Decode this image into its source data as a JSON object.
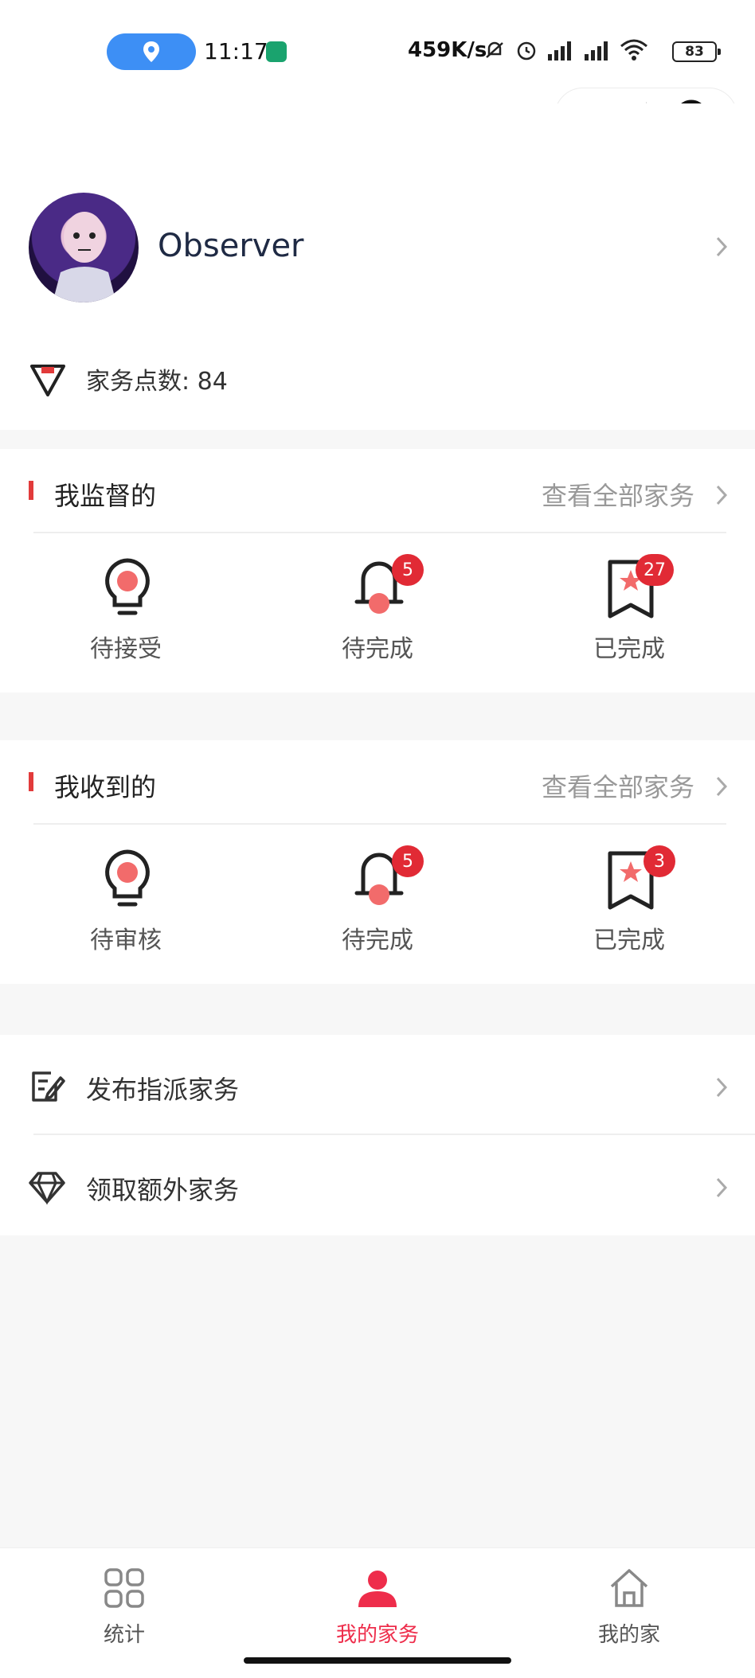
{
  "status_bar": {
    "time": "11:17",
    "net_speed": "459K/s",
    "battery": "83"
  },
  "profile": {
    "username": "Observer",
    "points_label": "家务点数: 84"
  },
  "supervise": {
    "title": "我监督的",
    "view_all": "查看全部家务",
    "items": [
      {
        "label": "待接受",
        "icon": "lightbulb-icon",
        "badge": ""
      },
      {
        "label": "待完成",
        "icon": "bell-icon",
        "badge": "5"
      },
      {
        "label": "已完成",
        "icon": "bookmark-star-icon",
        "badge": "27"
      }
    ]
  },
  "received": {
    "title": "我收到的",
    "view_all": "查看全部家务",
    "items": [
      {
        "label": "待审核",
        "icon": "lightbulb-icon",
        "badge": ""
      },
      {
        "label": "待完成",
        "icon": "bell-icon",
        "badge": "5"
      },
      {
        "label": "已完成",
        "icon": "bookmark-star-icon",
        "badge": "3"
      }
    ]
  },
  "menu": {
    "items": [
      {
        "label": "发布指派家务",
        "icon": "edit-note-icon"
      },
      {
        "label": "领取额外家务",
        "icon": "diamond-icon"
      }
    ]
  },
  "tabbar": {
    "tabs": [
      {
        "label": "统计",
        "icon": "grid-icon"
      },
      {
        "label": "我的家务",
        "icon": "person-icon",
        "active": true
      },
      {
        "label": "我的家",
        "icon": "home-icon"
      }
    ]
  },
  "colors": {
    "accent": "#e23b3b",
    "active_tab": "#ee2d4b",
    "icon_fill": "#f26b6b",
    "badge": "#e12a35",
    "location_pill": "#3d8ff5"
  }
}
